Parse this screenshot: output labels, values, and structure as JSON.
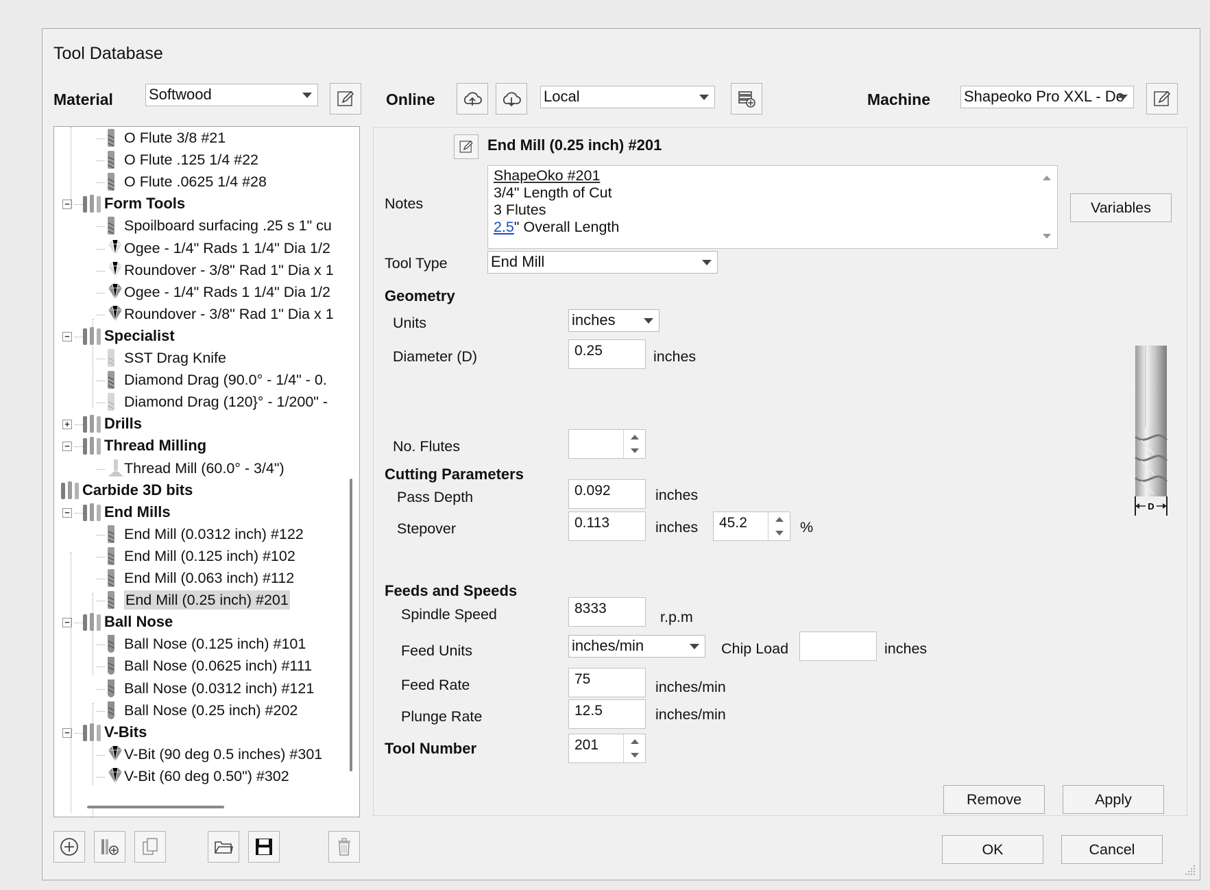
{
  "window": {
    "title": "Tool Database"
  },
  "header": {
    "material_label": "Material",
    "material_value": "Softwood",
    "online_label": "Online",
    "location_value": "Local",
    "machine_label": "Machine",
    "machine_value": "Shapeoko Pro XXL - De"
  },
  "tree": {
    "items": [
      {
        "label": "O Flute 3/8 #21"
      },
      {
        "label": "O Flute .125  1/4  #22"
      },
      {
        "label": "O Flute .0625  1/4  #28"
      },
      {
        "label": "Form Tools"
      },
      {
        "label": "Spoilboard surfacing .25 s 1\" cu"
      },
      {
        "label": "Ogee - 1/4\" Rads 1 1/4\" Dia 1/2"
      },
      {
        "label": "Roundover - 3/8\" Rad 1\" Dia x 1"
      },
      {
        "label": "Ogee - 1/4\" Rads 1 1/4\" Dia 1/2"
      },
      {
        "label": "Roundover - 3/8\" Rad 1\" Dia x 1"
      },
      {
        "label": "Specialist"
      },
      {
        "label": "SST Drag Knife"
      },
      {
        "label": "Diamond Drag (90.0° - 1/4\" - 0."
      },
      {
        "label": "Diamond Drag (120}° - 1/200\" -"
      },
      {
        "label": "Drills"
      },
      {
        "label": "Thread Milling"
      },
      {
        "label": "Thread Mill (60.0° - 3/4\")"
      },
      {
        "label": "Carbide 3D bits"
      },
      {
        "label": "End Mills"
      },
      {
        "label": "End Mill (0.0312 inch) #122"
      },
      {
        "label": "End Mill (0.125 inch) #102"
      },
      {
        "label": "End Mill (0.063 inch) #112"
      },
      {
        "label": "End Mill  (0.25 inch) #201"
      },
      {
        "label": "Ball Nose"
      },
      {
        "label": "Ball Nose (0.125 inch) #101"
      },
      {
        "label": "Ball Nose (0.0625 inch) #111"
      },
      {
        "label": "Ball Nose (0.0312 inch) #121"
      },
      {
        "label": "Ball Nose (0.25 inch) #202"
      },
      {
        "label": "V-Bits"
      },
      {
        "label": "V-Bit (90 deg 0.5 inches) #301"
      },
      {
        "label": "V-Bit (60 deg 0.50\") #302"
      }
    ]
  },
  "detail": {
    "tool_name": "End Mill  (0.25 inch) #201",
    "notes_label": "Notes",
    "notes_lines": [
      "ShapeOko #201",
      "3/4\" Length of Cut",
      "3 Flutes"
    ],
    "notes_link": "2.5",
    "notes_line4_rest": "\" Overall Length",
    "variables_button": "Variables",
    "tool_type_label": "Tool Type",
    "tool_type_value": "End Mill",
    "geometry_heading": "Geometry",
    "units_label": "Units",
    "units_value": "inches",
    "diameter_label": "Diameter (D)",
    "diameter_value": "0.25",
    "diameter_unit": "inches",
    "flutes_label": "No. Flutes",
    "flutes_value": "",
    "cutting_heading": "Cutting Parameters",
    "pass_depth_label": "Pass Depth",
    "pass_depth_value": "0.092",
    "pass_depth_unit": "inches",
    "stepover_label": "Stepover",
    "stepover_value": "0.113",
    "stepover_unit": "inches",
    "stepover_percent": "45.2",
    "percent_sign": "%",
    "feeds_heading": "Feeds and Speeds",
    "spindle_label": "Spindle Speed",
    "spindle_value": "8333",
    "spindle_unit": "r.p.m",
    "feed_units_label": "Feed Units",
    "feed_units_value": "inches/min",
    "chip_load_label": "Chip Load",
    "chip_load_value": "",
    "chip_load_unit": "inches",
    "feed_rate_label": "Feed Rate",
    "feed_rate_value": "75",
    "feed_rate_unit": "inches/min",
    "plunge_label": "Plunge Rate",
    "plunge_value": "12.5",
    "plunge_unit": "inches/min",
    "tool_number_label": "Tool Number",
    "tool_number_value": "201",
    "remove_button": "Remove",
    "apply_button": "Apply",
    "diagram_label": "D"
  },
  "footer": {
    "ok_button": "OK",
    "cancel_button": "Cancel"
  }
}
